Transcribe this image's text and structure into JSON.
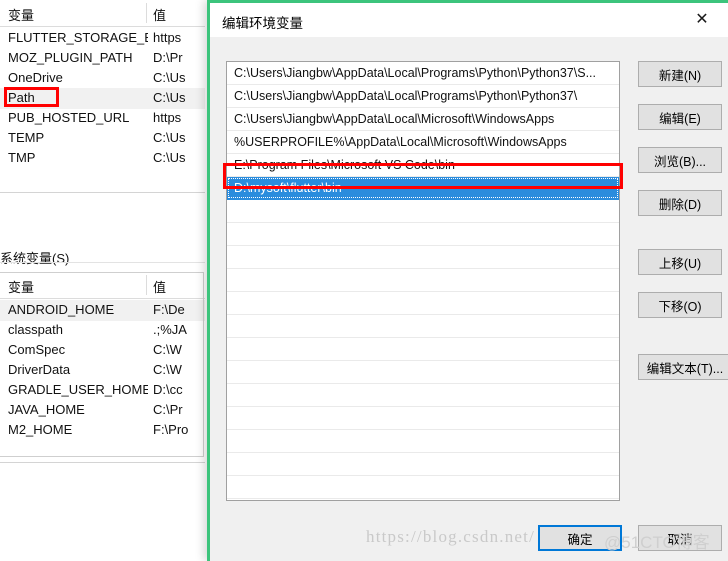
{
  "background_window": {
    "user_section": {
      "columns": {
        "name": "变量",
        "value": "值"
      },
      "rows": [
        {
          "name": "FLUTTER_STORAGE_BASE_",
          "value": "https"
        },
        {
          "name": "MOZ_PLUGIN_PATH",
          "value": "D:\\Pr"
        },
        {
          "name": "OneDrive",
          "value": "C:\\Us"
        },
        {
          "name": "Path",
          "value": "C:\\Us"
        },
        {
          "name": "PUB_HOSTED_URL",
          "value": "https"
        },
        {
          "name": "TEMP",
          "value": "C:\\Us"
        },
        {
          "name": "TMP",
          "value": "C:\\Us"
        }
      ],
      "selected_row": "Path"
    },
    "system_section": {
      "label": "系统变量(S)",
      "columns": {
        "name": "变量",
        "value": "值"
      },
      "rows": [
        {
          "name": "ANDROID_HOME",
          "value": "F:\\De"
        },
        {
          "name": "classpath",
          "value": ".;%JA"
        },
        {
          "name": "ComSpec",
          "value": "C:\\W"
        },
        {
          "name": "DriverData",
          "value": "C:\\W"
        },
        {
          "name": "GRADLE_USER_HOME",
          "value": "D:\\cc"
        },
        {
          "name": "JAVA_HOME",
          "value": "C:\\Pr"
        },
        {
          "name": "M2_HOME",
          "value": "F:\\Pro"
        }
      ],
      "selected_row": "ANDROID_HOME"
    }
  },
  "dialog": {
    "title": "编辑环境变量",
    "close_label": "✕",
    "path_entries": [
      "C:\\Users\\Jiangbw\\AppData\\Local\\Programs\\Python\\Python37\\S...",
      "C:\\Users\\Jiangbw\\AppData\\Local\\Programs\\Python\\Python37\\",
      "C:\\Users\\Jiangbw\\AppData\\Local\\Microsoft\\WindowsApps",
      "%USERPROFILE%\\AppData\\Local\\Microsoft\\WindowsApps",
      "E:\\Program Files\\Microsoft VS Code\\bin",
      "D:\\mysoft\\flutter\\bin"
    ],
    "selected_entry_index": 5,
    "side_buttons": [
      {
        "label": "新建(N)",
        "name": "new"
      },
      {
        "label": "编辑(E)",
        "name": "edit"
      },
      {
        "label": "浏览(B)...",
        "name": "browse"
      },
      {
        "label": "删除(D)",
        "name": "delete"
      },
      {
        "label": "上移(U)",
        "name": "move-up"
      },
      {
        "label": "下移(O)",
        "name": "move-down"
      },
      {
        "label": "编辑文本(T)...",
        "name": "edit-text"
      }
    ],
    "ok_label": "确定",
    "cancel_label": "取消"
  },
  "watermarks": {
    "csdn": "https://blog.csdn.net/",
    "cto": "@51CTO博客"
  },
  "colors": {
    "selection_blue": "#2a8cdd",
    "annotation_red": "#ff0000",
    "dialog_border_green": "#3cc47c",
    "focus_blue": "#0078d7",
    "dialog_bg": "#f0f0f0"
  }
}
